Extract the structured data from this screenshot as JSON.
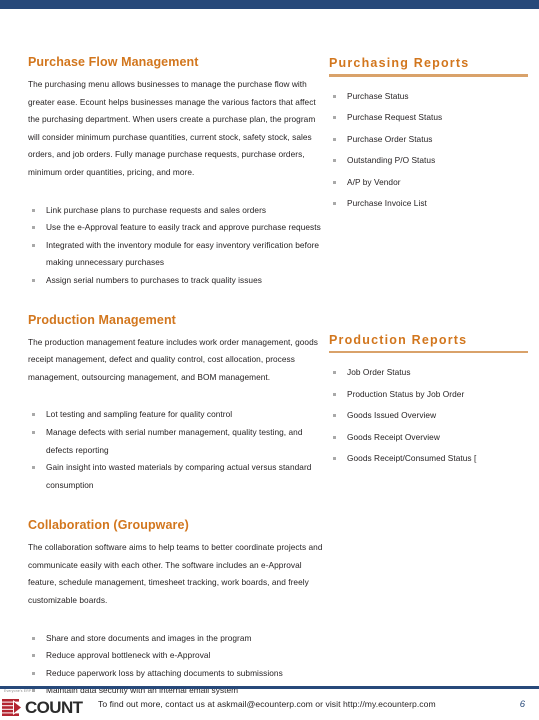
{
  "theme": {
    "top_bar_color": "#27497a",
    "heading_color": "#d2761d",
    "rule_color": "#d9a26a",
    "body_text_color": "#231f20",
    "bullet_color": "#a9a9a9",
    "footer_rule_color": "#27497a",
    "logo_mark_color": "#b32430",
    "page_number_color": "#27497a"
  },
  "sections": {
    "purchase_flow": {
      "title": "Purchase Flow Management",
      "paragraph": "The purchasing menu allows businesses to manage the purchase flow with greater ease. Ecount helps businesses manage the various factors that affect the purchasing department. When users create a purchase plan, the program will consider minimum purchase quantities, current stock, safety stock, sales orders, and job orders. Fully manage purchase requests, purchase orders, minimum order quantities, pricing, and more.",
      "bullets": [
        "Link purchase plans to purchase requests and sales orders",
        "Use the e-Approval feature to easily track and approve purchase requests",
        "Integrated with the inventory module for easy inventory verification before making unnecessary purchases",
        "Assign serial numbers to purchases to track quality issues"
      ]
    },
    "production_management": {
      "title": "Production Management",
      "paragraph": "The production management feature includes work order management, goods receipt management, defect and quality control, cost allocation, process management, outsourcing management, and BOM management.",
      "bullets": [
        "Lot testing and sampling feature for quality control",
        "Manage defects with serial number management, quality testing, and defects reporting",
        "Gain insight into wasted materials by comparing actual versus standard consumption"
      ]
    },
    "collaboration": {
      "title": "Collaboration (Groupware)",
      "paragraph": "The collaboration software aims to help teams to better coordinate projects and communicate easily with each other. The software includes an e-Approval feature, schedule management, timesheet tracking, work boards, and freely customizable boards.",
      "bullets": [
        "Share and store documents and images in the program",
        "Reduce approval bottleneck with e-Approval",
        "Reduce paperwork loss by attaching documents to submissions",
        "Maintain data security with an internal email system"
      ]
    },
    "purchasing_reports": {
      "title": "Purchasing Reports",
      "items": [
        "Purchase Status",
        "Purchase Request Status",
        "Purchase Order Status",
        "Outstanding P/O Status",
        "A/P by Vendor",
        "Purchase Invoice List"
      ]
    },
    "production_reports": {
      "title": "Production Reports",
      "items": [
        "Job Order Status",
        "Production Status by Job Order",
        "Goods Issued Overview",
        "Goods Receipt Overview",
        "Goods Receipt/Consumed Status ["
      ]
    }
  },
  "footer": {
    "logo_text": "COUNT",
    "logo_tagline": "Everyone's ERP",
    "contact_text": "To find out more, contact us at askmail@ecounterp.com or visit http://my.ecounterp.com",
    "page_number": "6"
  }
}
